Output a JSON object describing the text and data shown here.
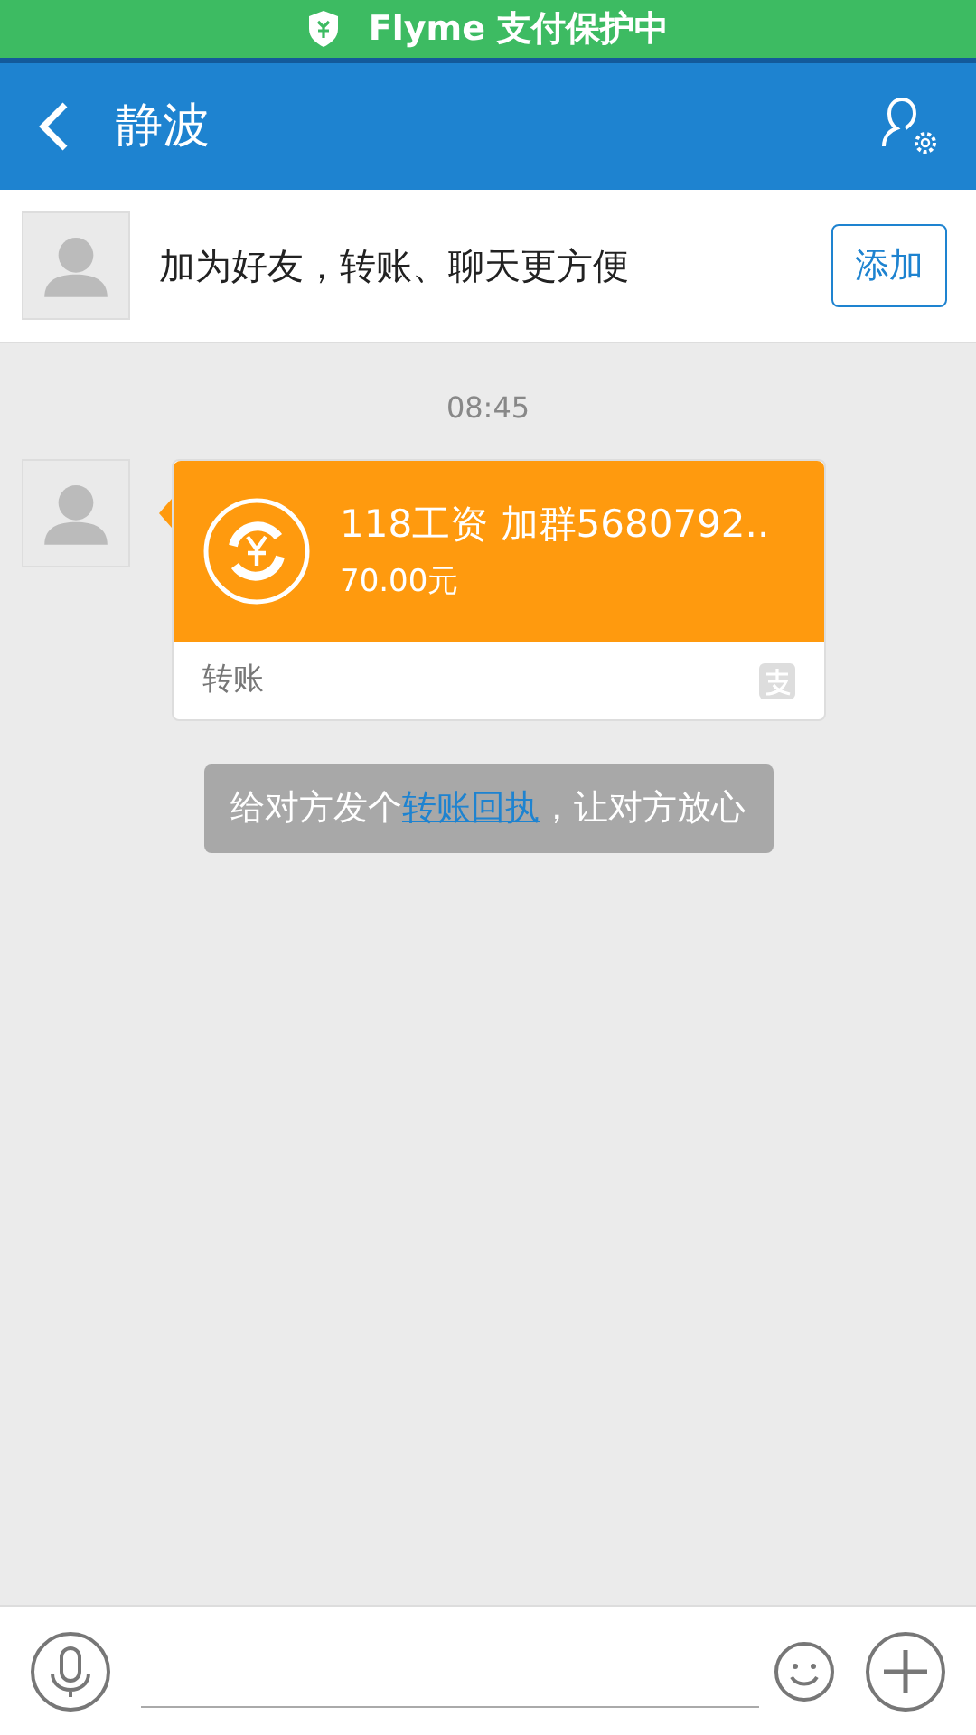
{
  "status_bar": {
    "text": "Flyme 支付保护中"
  },
  "header": {
    "title": "静波"
  },
  "friend_bar": {
    "text": "加为好友，转账、聊天更方便",
    "button": "添加"
  },
  "messages": [
    {
      "kind": "time",
      "text": "08:45"
    },
    {
      "kind": "transfer",
      "title": "118工资  加群5680792..",
      "amount": "70.00元",
      "footer": "转账"
    },
    {
      "kind": "notice",
      "before": "给对方发个",
      "link": "转账回执",
      "after": "，让对方放心"
    }
  ]
}
